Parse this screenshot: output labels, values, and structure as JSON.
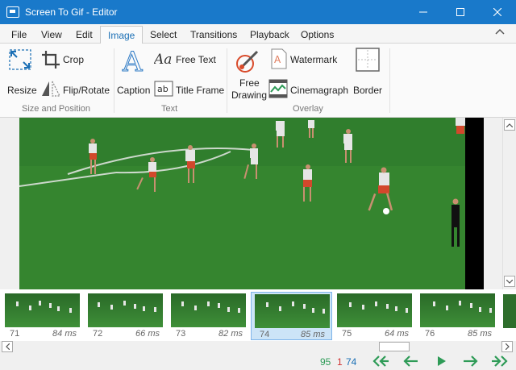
{
  "window": {
    "title": "Screen To Gif - Editor"
  },
  "menu": {
    "items": [
      "File",
      "View",
      "Edit",
      "Image",
      "Select",
      "Transitions",
      "Playback",
      "Options"
    ],
    "active": "Image"
  },
  "ribbon": {
    "size_position": {
      "label": "Size and Position",
      "resize": "Resize",
      "crop": "Crop",
      "flip_rotate": "Flip/Rotate"
    },
    "text": {
      "label": "Text",
      "caption": "Caption",
      "free_text": "Free Text",
      "title_frame": "Title Frame"
    },
    "overlay": {
      "label": "Overlay",
      "free_drawing_line1": "Free",
      "free_drawing_line2": "Drawing",
      "watermark": "Watermark",
      "cinemagraph": "Cinemagraph",
      "border": "Border"
    }
  },
  "frames": [
    {
      "number": "71",
      "delay": "84 ms"
    },
    {
      "number": "72",
      "delay": "66 ms"
    },
    {
      "number": "73",
      "delay": "82 ms"
    },
    {
      "number": "74",
      "delay": "85 ms"
    },
    {
      "number": "75",
      "delay": "64 ms"
    },
    {
      "number": "76",
      "delay": "85 ms"
    }
  ],
  "selected_frame": "74",
  "status": {
    "total": "95",
    "selected_count": "1",
    "current": "74"
  },
  "colors": {
    "titlebar": "#1979ca",
    "accent": "#1a6fb5",
    "nav_green": "#2e9b57",
    "field_green": "#3a8832"
  }
}
